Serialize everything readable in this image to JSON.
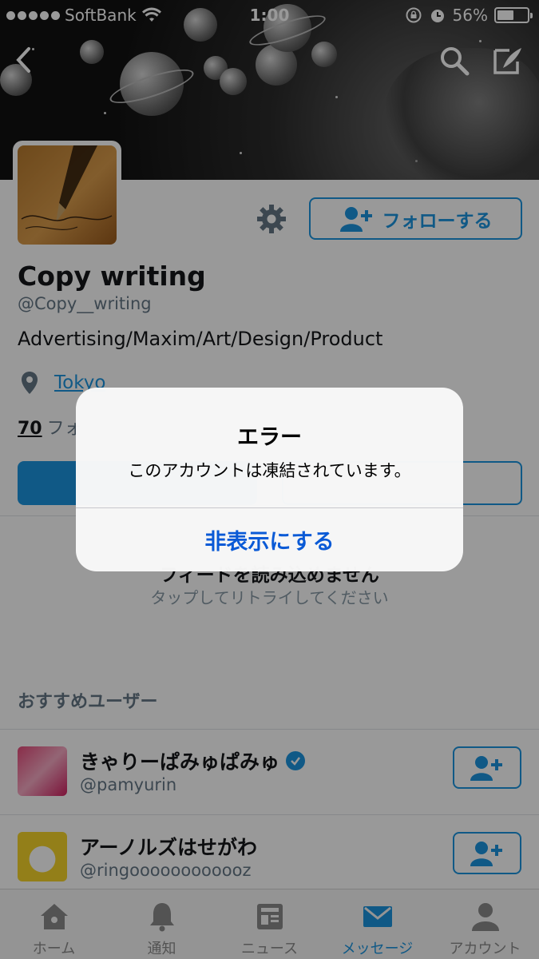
{
  "status_bar": {
    "carrier": "SoftBank",
    "time": "1:00",
    "battery_percent": "56%",
    "battery_level": 0.56,
    "icons": [
      "signal-dots-icon",
      "wifi-icon",
      "rotation-lock-icon",
      "alarm-icon",
      "battery-icon"
    ]
  },
  "header": {
    "back_icon": "chevron-left-icon",
    "search_icon": "search-icon",
    "compose_icon": "compose-icon"
  },
  "profile": {
    "name": "Copy writing",
    "handle": "@Copy__writing",
    "bio": "Advertising/Maxim/Art/Design/Product",
    "location": "Tokyo",
    "count_value": "70",
    "count_label": "フォ",
    "follow_label": "フォローする",
    "settings_icon": "gear-icon"
  },
  "feed": {
    "error_title": "フィードを読み込めません",
    "error_hint": "タップしてリトライしてください"
  },
  "recommended": {
    "header": "おすすめユーザー",
    "users": [
      {
        "name": "きゃりーぱみゅぱみゅ",
        "handle": "@pamyurin",
        "verified": true
      },
      {
        "name": "アーノルズはせがわ",
        "handle": "@ringoooooooooooz",
        "verified": false
      }
    ]
  },
  "tab_bar": {
    "tabs": [
      {
        "label": "ホーム",
        "icon": "home-icon"
      },
      {
        "label": "通知",
        "icon": "bell-icon"
      },
      {
        "label": "ニュース",
        "icon": "news-icon"
      },
      {
        "label": "メッセージ",
        "icon": "envelope-icon"
      },
      {
        "label": "アカウント",
        "icon": "person-icon"
      }
    ],
    "active_tab": "メッセージ"
  },
  "alert": {
    "title": "エラー",
    "message": "このアカウントは凍結されています。",
    "button_label": "非表示にする"
  },
  "colors": {
    "accent": "#1b95e0",
    "alert_button": "#0a5ad6"
  }
}
